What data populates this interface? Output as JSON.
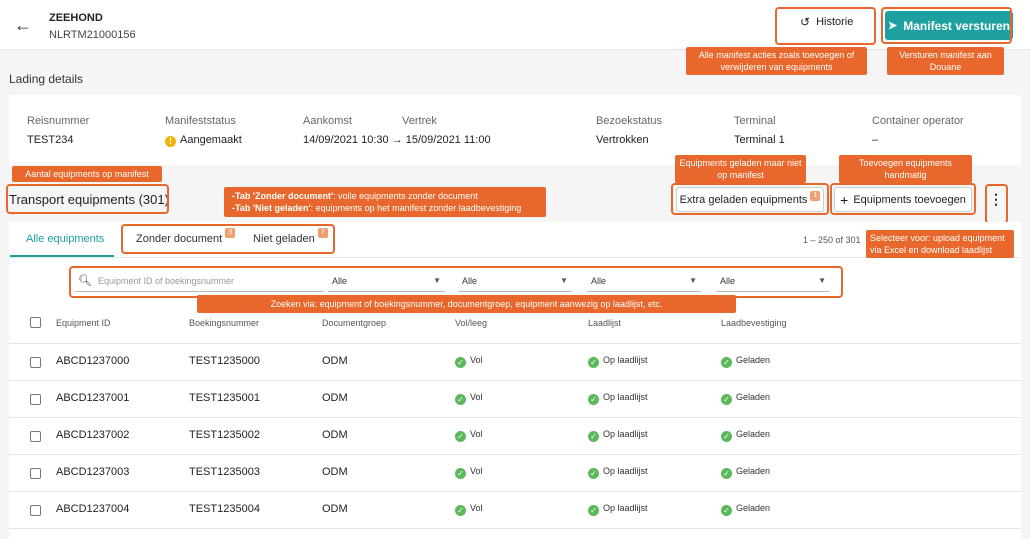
{
  "header": {
    "vessel_name": "ZEEHOND",
    "vessel_id": "NLRTM21000156",
    "history_label": "Historie",
    "send_label": "Manifest versturen"
  },
  "section_title": "Lading details",
  "details": [
    {
      "label": "Reisnummer",
      "value": "TEST234"
    },
    {
      "label": "Manifeststatus",
      "value": "Aangemaakt"
    },
    {
      "label": "Aankomst",
      "value": "14/09/2021 10:30 → 15/09/2021 11:00"
    },
    {
      "label": "Vertrek",
      "value": ""
    },
    {
      "label": "Bezoekstatus",
      "value": "Vertrokken"
    },
    {
      "label": "Terminal",
      "value": "Terminal 1"
    },
    {
      "label": "Container operator",
      "value": "–"
    }
  ],
  "equipments": {
    "title": "Transport equipments (301)",
    "extra_loaded_label": "Extra geladen equipments",
    "extra_loaded_badge": "1",
    "add_label": "Equipments toevoegen",
    "pagination": "1 – 250 of 301"
  },
  "tabs": [
    {
      "label": "Alle equipments",
      "badge": ""
    },
    {
      "label": "Zonder document",
      "badge": "3"
    },
    {
      "label": "Niet geladen",
      "badge": "7"
    }
  ],
  "filters": {
    "search_placeholder": "Equipment ID of boekingsnummer",
    "selects": [
      "Alle",
      "Alle",
      "Alle",
      "Alle"
    ]
  },
  "table": {
    "headers": [
      "Equipment ID",
      "Boekingsnummer",
      "Documentgroep",
      "Vol/leeg",
      "Laadlijst",
      "Laadbevestiging"
    ],
    "rows": [
      [
        "ABCD1237000",
        "TEST1235000",
        "ODM",
        "Vol",
        "Op laadlijst",
        "Geladen"
      ],
      [
        "ABCD1237001",
        "TEST1235001",
        "ODM",
        "Vol",
        "Op laadlijst",
        "Geladen"
      ],
      [
        "ABCD1237002",
        "TEST1235002",
        "ODM",
        "Vol",
        "Op laadlijst",
        "Geladen"
      ],
      [
        "ABCD1237003",
        "TEST1235003",
        "ODM",
        "Vol",
        "Op laadlijst",
        "Geladen"
      ],
      [
        "ABCD1237004",
        "TEST1235004",
        "ODM",
        "Vol",
        "Op laadlijst",
        "Geladen"
      ]
    ]
  },
  "callouts": {
    "manifest_actions": "Alle manifest acties zoals toevoegen of verwijderen van equipments",
    "send_manifest": "Versturen manifest aan Douane",
    "count_equipments": "Aantal equipments op manifest",
    "loaded_not_on_manifest": "Equipments geladen maar niet op manifest",
    "add_manually": "Toevoegen equipments handmatig",
    "tabs_explain_1_bold": "-Tab 'Zonder document'",
    "tabs_explain_1": ": volle equipments zonder document",
    "tabs_explain_2_bold": "-Tab 'Niet geladen'",
    "tabs_explain_2": ": equipments op het manifest zonder laadbevestiging",
    "select_explain": "Selecteer voor: upload equipment via Excel en download laadlijst",
    "search_explain": "Zoeken via: equipment of boekingsnummer, documentgroep, equipment aanwezig op laadlijst, etc."
  },
  "colors": {
    "accent": "#1fa0a0",
    "callout": "#e8672c",
    "ok": "#5cb85c",
    "warning": "#f0b400"
  }
}
